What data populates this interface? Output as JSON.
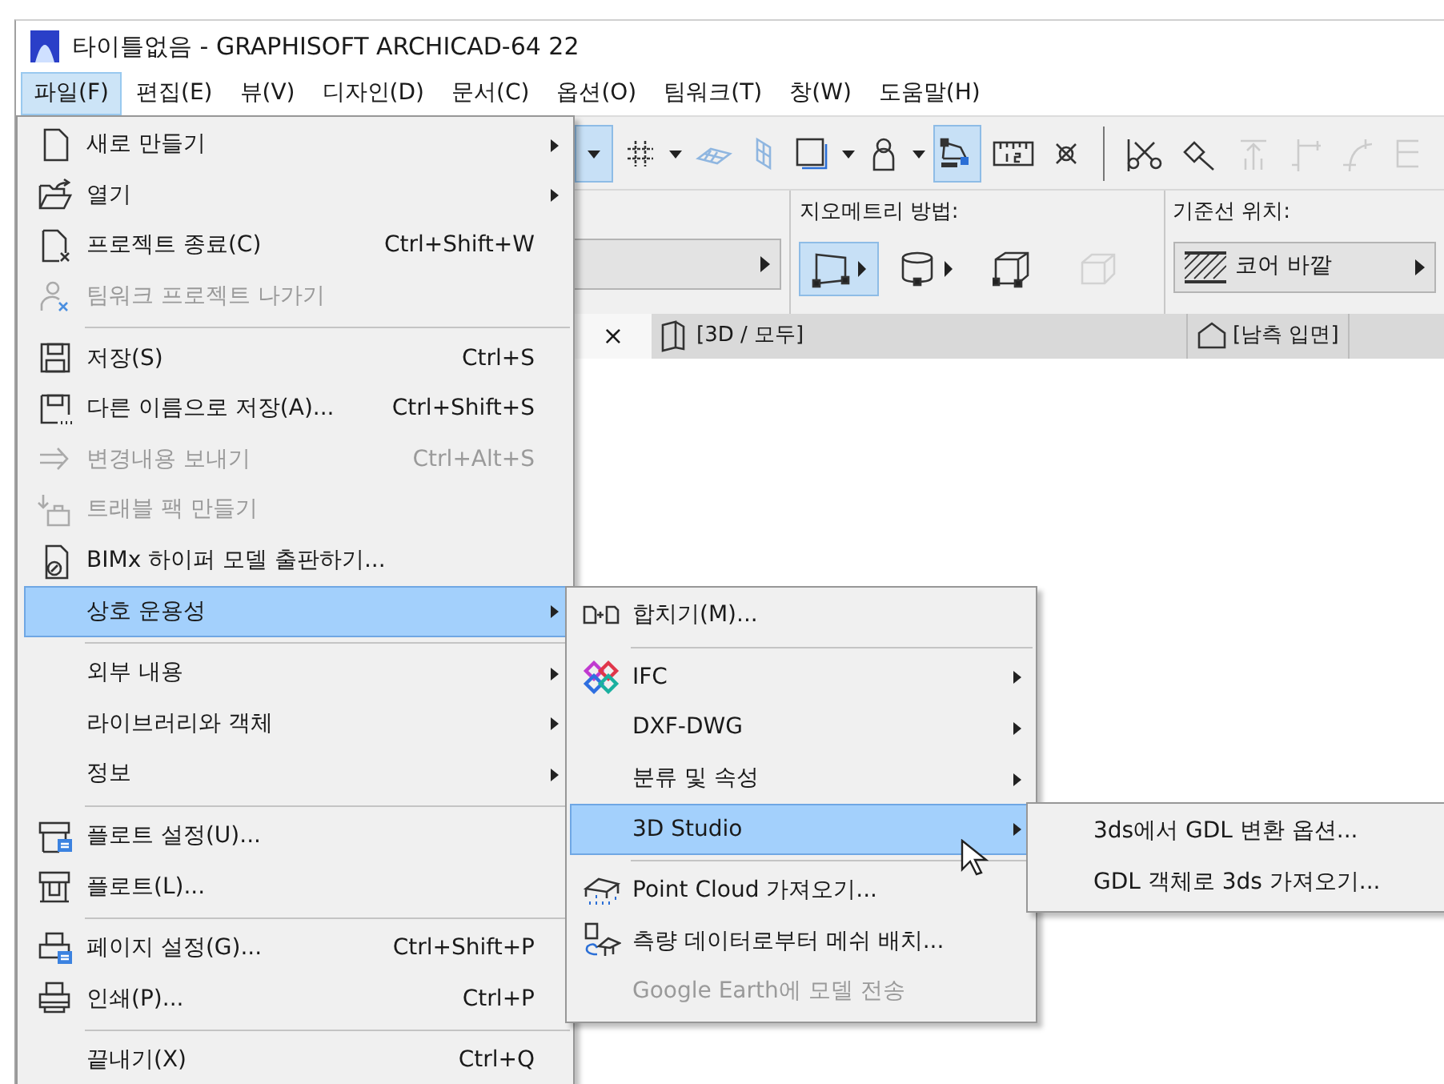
{
  "window": {
    "title": "타이틀없음 - GRAPHISOFT ARCHICAD-64 22"
  },
  "menubar": [
    {
      "label": "파일(F)",
      "selected": true
    },
    {
      "label": "편집(E)",
      "selected": false
    },
    {
      "label": "뷰(V)",
      "selected": false
    },
    {
      "label": "디자인(D)",
      "selected": false
    },
    {
      "label": "문서(C)",
      "selected": false
    },
    {
      "label": "옵션(O)",
      "selected": false
    },
    {
      "label": "팀워크(T)",
      "selected": false
    },
    {
      "label": "창(W)",
      "selected": false
    },
    {
      "label": "도움말(H)",
      "selected": false
    }
  ],
  "toolbar": [
    {
      "selected": true,
      "disabled": false
    },
    {
      "selected": false,
      "disabled": false
    },
    {
      "selected": false,
      "disabled": false
    },
    {
      "selected": false,
      "disabled": false
    },
    {
      "selected": false,
      "disabled": false
    },
    {
      "selected": false,
      "disabled": false
    },
    {
      "selected": true,
      "disabled": false
    },
    {
      "selected": false,
      "disabled": false
    },
    {
      "selected": false,
      "disabled": false
    },
    {
      "selected": false,
      "disabled": false
    },
    {
      "selected": false,
      "disabled": false
    },
    {
      "selected": false,
      "disabled": true
    },
    {
      "selected": false,
      "disabled": true
    },
    {
      "selected": false,
      "disabled": true
    },
    {
      "selected": false,
      "disabled": true
    }
  ],
  "info_box": {
    "geometry": {
      "label": "지오메트리 방법:",
      "options": [
        {
          "selected": true,
          "disabled": false
        },
        {
          "selected": false,
          "disabled": false
        },
        {
          "selected": false,
          "disabled": false
        },
        {
          "selected": false,
          "disabled": true
        }
      ]
    },
    "reference_line": {
      "label": "기준선 위치:",
      "value": "코어 바깥"
    }
  },
  "view_tabs": {
    "close": "×",
    "tabs": [
      {
        "label": "[3D / 모두]",
        "selected": false
      },
      {
        "label": "[남측 입면]",
        "selected": false
      }
    ]
  },
  "file_menu": [
    {
      "kind": "item",
      "label": "새로 만들기",
      "submenu": true,
      "disabled": false,
      "selected": false
    },
    {
      "kind": "item",
      "label": "열기",
      "submenu": true,
      "disabled": false,
      "selected": false
    },
    {
      "kind": "item",
      "label": "프로젝트 종료(C)",
      "shortcut": "Ctrl+Shift+W",
      "submenu": false,
      "disabled": false,
      "selected": false
    },
    {
      "kind": "item",
      "label": "팀워크 프로젝트 나가기",
      "submenu": false,
      "disabled": true,
      "selected": false
    },
    {
      "kind": "separator"
    },
    {
      "kind": "item",
      "label": "저장(S)",
      "shortcut": "Ctrl+S",
      "submenu": false,
      "disabled": false,
      "selected": false
    },
    {
      "kind": "item",
      "label": "다른 이름으로 저장(A)...",
      "shortcut": "Ctrl+Shift+S",
      "submenu": false,
      "disabled": false,
      "selected": false
    },
    {
      "kind": "item",
      "label": "변경내용 보내기",
      "shortcut": "Ctrl+Alt+S",
      "submenu": false,
      "disabled": true,
      "selected": false
    },
    {
      "kind": "item",
      "label": "트래블 팩 만들기",
      "submenu": false,
      "disabled": true,
      "selected": false
    },
    {
      "kind": "item",
      "label": "BIMx 하이퍼 모델 출판하기...",
      "submenu": false,
      "disabled": false,
      "selected": false
    },
    {
      "kind": "item",
      "label": "상호 운용성",
      "submenu": true,
      "disabled": false,
      "selected": true
    },
    {
      "kind": "separator"
    },
    {
      "kind": "item",
      "label": "외부 내용",
      "submenu": true,
      "disabled": false,
      "selected": false
    },
    {
      "kind": "item",
      "label": "라이브러리와 객체",
      "submenu": true,
      "disabled": false,
      "selected": false
    },
    {
      "kind": "item",
      "label": "정보",
      "submenu": true,
      "disabled": false,
      "selected": false
    },
    {
      "kind": "separator"
    },
    {
      "kind": "item",
      "label": "플로트 설정(U)...",
      "submenu": false,
      "disabled": false,
      "selected": false
    },
    {
      "kind": "item",
      "label": "플로트(L)...",
      "submenu": false,
      "disabled": false,
      "selected": false
    },
    {
      "kind": "separator"
    },
    {
      "kind": "item",
      "label": "페이지 설정(G)...",
      "shortcut": "Ctrl+Shift+P",
      "submenu": false,
      "disabled": false,
      "selected": false
    },
    {
      "kind": "item",
      "label": "인쇄(P)...",
      "shortcut": "Ctrl+P",
      "submenu": false,
      "disabled": false,
      "selected": false
    },
    {
      "kind": "separator"
    },
    {
      "kind": "item",
      "label": "끝내기(X)",
      "shortcut": "Ctrl+Q",
      "submenu": false,
      "disabled": false,
      "selected": false
    }
  ],
  "interoperability_menu": [
    {
      "kind": "item",
      "label": "합치기(M)...",
      "submenu": false,
      "disabled": false,
      "selected": false
    },
    {
      "kind": "separator"
    },
    {
      "kind": "item",
      "label": "IFC",
      "submenu": true,
      "disabled": false,
      "selected": false
    },
    {
      "kind": "item",
      "label": "DXF-DWG",
      "submenu": true,
      "disabled": false,
      "selected": false
    },
    {
      "kind": "item",
      "label": "분류 및 속성",
      "submenu": true,
      "disabled": false,
      "selected": false
    },
    {
      "kind": "item",
      "label": "3D Studio",
      "submenu": true,
      "disabled": false,
      "selected": true
    },
    {
      "kind": "separator"
    },
    {
      "kind": "item",
      "label": "Point Cloud 가져오기...",
      "submenu": false,
      "disabled": false,
      "selected": false
    },
    {
      "kind": "item",
      "label": "측량 데이터로부터 메쉬 배치...",
      "submenu": false,
      "disabled": false,
      "selected": false
    },
    {
      "kind": "item",
      "label": "Google Earth에 모델 전송",
      "submenu": false,
      "disabled": true,
      "selected": false
    }
  ],
  "studio_menu": [
    {
      "kind": "item",
      "label": "3ds에서 GDL 변환 옵션...",
      "disabled": false,
      "selected": false
    },
    {
      "kind": "item",
      "label": "GDL 객체로 3ds 가져오기...",
      "disabled": false,
      "selected": false
    }
  ]
}
